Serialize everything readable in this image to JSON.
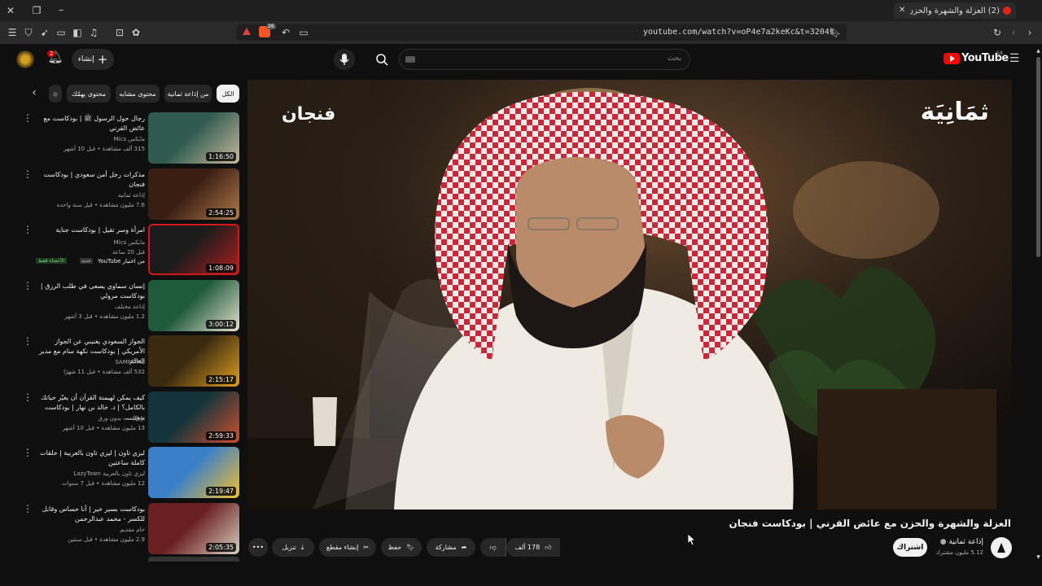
{
  "browser": {
    "tab_title": "(2) العزلة والشهرة والحزن مع عا",
    "url": "youtube.com/watch?v=oP4e7a2keKc&t=3204s",
    "shield_count": "26"
  },
  "header": {
    "logo_text": "YouTube",
    "region": "SA",
    "search_placeholder": "بحث",
    "create_label": "إنشاء",
    "notification_count": "2"
  },
  "chips": [
    "الكل",
    "من إذاعة ثمانية",
    "محتوى مشابه",
    "محتوى يهمّك"
  ],
  "video": {
    "overlay_left": "فنجان",
    "overlay_right": "ثمَانِيَة",
    "title": "العزلة والشهرة والحزن مع عائض القرني | بودكاست فنجان",
    "channel": "إذاعة ثمانية",
    "subscribers": "5.12 مليون مشترك",
    "subscribe_label": "اشتراك",
    "like_count": "178 ألف",
    "share_label": "مشاركة",
    "save_label": "حفظ",
    "clip_label": "إنشاء مقطع",
    "download_label": "تنزيل"
  },
  "recommendations": [
    {
      "title": "رجال حول الرسول ﷺ | بودكاست مع عائض القرني",
      "channel": "مايكس Mics",
      "meta": "315 ألف مشاهدة • قبل 10 أشهر",
      "duration": "1:16:50",
      "colors": [
        "#2e5a50",
        "#c9b89a"
      ]
    },
    {
      "title": "مذكرات رجل أمن سعودي | بودكاست فنجان",
      "channel": "إذاعة ثمانية",
      "meta": "7.6 مليون مشاهدة • قبل سنة واحدة",
      "duration": "2:54:25",
      "colors": [
        "#3b1e12",
        "#b07a4a"
      ]
    },
    {
      "title": "امرأة وسر تقيل | بودكاست جناية",
      "channel": "مايكس Mics",
      "meta": "قبل 20 ساعة",
      "extra": "من اختيار YouTube",
      "badge_new": "جديد",
      "badge_vip": "الأعضاء فقط",
      "duration": "1:08:09",
      "colors": [
        "#1b1b1b",
        "#b02020"
      ]
    },
    {
      "title": "إنسان سماوي يسعى في طلب الرزق | بودكاست مرولي",
      "channel": "إذاعة مختلف",
      "meta": "1.2 مليون مشاهدة • قبل 3 أشهر",
      "duration": "3:00:12",
      "colors": [
        "#1f5a3a",
        "#e6e0d0"
      ]
    },
    {
      "title": "الجواز السعودي يغنيني عن الجواز الأمريكي | بودكاست نكهة سام مع مدير العالم",
      "channel": "SAM6TIME",
      "meta": "532 ألف مشاهدة • قبل 11 شهرًا",
      "duration": "2:15:17",
      "colors": [
        "#3a2a10",
        "#e0a020"
      ]
    },
    {
      "title": "كيف يمكن لهيمنة القرآن أن يغيّر حياتك بالكامل؟ | د. خالد بن نهار | بودكاست بدون...",
      "channel": "بودكاست بدون ورق",
      "meta": "13 مليون مشاهدة • قبل 10 أشهر",
      "duration": "2:59:33",
      "colors": [
        "#12343a",
        "#d05030"
      ]
    },
    {
      "title": "ليزي تاون | ليزي تاون بالعربية | حلقات كاملة ساعتين",
      "channel": "ليزي تاون بالعربية LazyTown",
      "meta": "12 مليون مشاهدة • قبل 7 سنوات",
      "duration": "2:19:47",
      "colors": [
        "#3a7fc8",
        "#f2c030"
      ]
    },
    {
      "title": "بودكاست بسير خير | أنا حساس وقابل للكسر - محمد عبدالرحمن",
      "channel": "حام مقديم",
      "meta": "2.9 مليون مشاهدة • قبل سنتين",
      "duration": "2:05:35",
      "colors": [
        "#6a2020",
        "#d8d0c0"
      ]
    }
  ]
}
